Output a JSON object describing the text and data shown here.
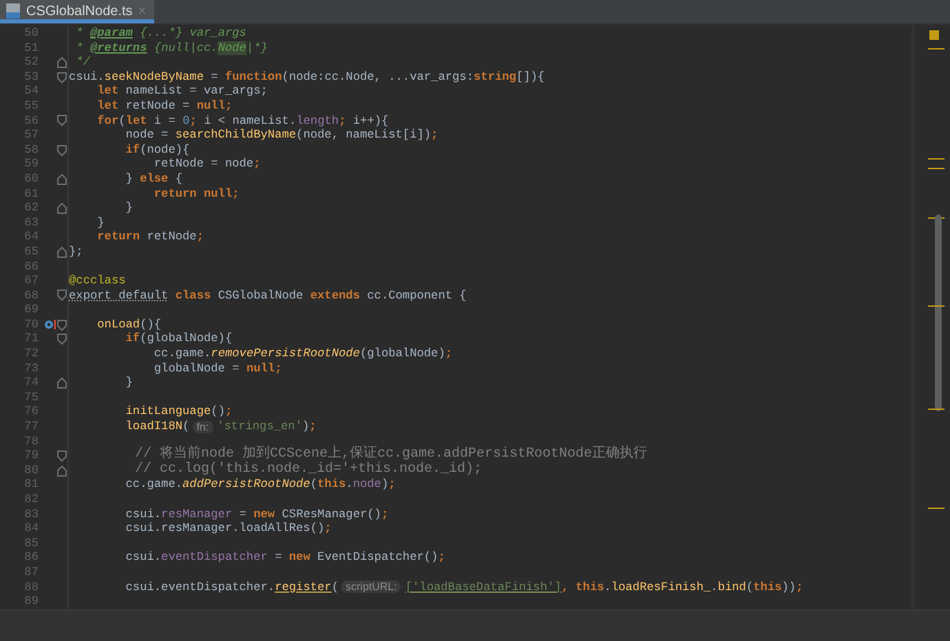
{
  "tabs": [
    {
      "label": "CSGlobalNode.ts",
      "close": "×",
      "selected": true
    }
  ],
  "lines": [
    {
      "number": "50",
      "fold_start": false,
      "fold_end": false,
      "override": false,
      "tokens": [
        {
          "kind": "doc",
          "text": " * "
        },
        {
          "kind": "doctag",
          "text": "@param"
        },
        {
          "kind": "doc",
          "text": " {...*} var_args"
        }
      ]
    },
    {
      "number": "51",
      "fold_start": false,
      "fold_end": false,
      "override": false,
      "tokens": [
        {
          "kind": "doc",
          "text": " * "
        },
        {
          "kind": "doctag",
          "text": "@returns"
        },
        {
          "kind": "doc",
          "text": " {null|cc."
        },
        {
          "kind": "docref",
          "text": "Node"
        },
        {
          "kind": "doc",
          "text": "|*}"
        }
      ]
    },
    {
      "number": "52",
      "fold_start": false,
      "fold_end": true,
      "override": false,
      "tokens": [
        {
          "kind": "doc",
          "text": " */"
        }
      ]
    },
    {
      "number": "53",
      "fold_start": true,
      "fold_end": false,
      "override": false,
      "tokens": [
        {
          "kind": "plain",
          "text": "csui."
        },
        {
          "kind": "function",
          "text": "seekNodeByName"
        },
        {
          "kind": "plain",
          "text": " = "
        },
        {
          "kind": "keyword",
          "text": "function"
        },
        {
          "kind": "plain",
          "text": "(node:cc.Node, ...var_args:"
        },
        {
          "kind": "keyword",
          "text": "string"
        },
        {
          "kind": "plain",
          "text": "[]){"
        }
      ]
    },
    {
      "number": "54",
      "fold_start": false,
      "fold_end": false,
      "override": false,
      "tokens": [
        {
          "kind": "keyword",
          "text": "    let"
        },
        {
          "kind": "plain",
          "text": " nameList = var_args;"
        }
      ]
    },
    {
      "number": "55",
      "fold_start": false,
      "fold_end": false,
      "override": false,
      "tokens": [
        {
          "kind": "keyword",
          "text": "    let"
        },
        {
          "kind": "plain",
          "text": " retNode = "
        },
        {
          "kind": "keyword",
          "text": "null;"
        }
      ]
    },
    {
      "number": "56",
      "fold_start": true,
      "fold_end": false,
      "override": false,
      "tokens": [
        {
          "kind": "keyword",
          "text": "    for"
        },
        {
          "kind": "plain",
          "text": "("
        },
        {
          "kind": "keyword",
          "text": "let"
        },
        {
          "kind": "plain",
          "text": " i = "
        },
        {
          "kind": "number",
          "text": "0"
        },
        {
          "kind": "keyword",
          "text": ";"
        },
        {
          "kind": "plain",
          "text": " i < nameList."
        },
        {
          "kind": "field",
          "text": "length"
        },
        {
          "kind": "keyword",
          "text": ";"
        },
        {
          "kind": "plain",
          "text": " i++){"
        }
      ]
    },
    {
      "number": "57",
      "fold_start": false,
      "fold_end": false,
      "override": false,
      "tokens": [
        {
          "kind": "plain",
          "text": "        node = "
        },
        {
          "kind": "function",
          "text": "searchChildByName"
        },
        {
          "kind": "plain",
          "text": "(node, nameList[i])"
        },
        {
          "kind": "keyword",
          "text": ";"
        }
      ]
    },
    {
      "number": "58",
      "fold_start": true,
      "fold_end": false,
      "override": false,
      "tokens": [
        {
          "kind": "keyword",
          "text": "        if"
        },
        {
          "kind": "plain",
          "text": "(node){"
        }
      ]
    },
    {
      "number": "59",
      "fold_start": false,
      "fold_end": false,
      "override": false,
      "tokens": [
        {
          "kind": "plain",
          "text": "            retNode = node"
        },
        {
          "kind": "keyword",
          "text": ";"
        }
      ]
    },
    {
      "number": "60",
      "fold_start": false,
      "fold_end": true,
      "override": false,
      "tokens": [
        {
          "kind": "plain",
          "text": "        } "
        },
        {
          "kind": "keyword",
          "text": "else"
        },
        {
          "kind": "plain",
          "text": " {"
        }
      ]
    },
    {
      "number": "61",
      "fold_start": false,
      "fold_end": false,
      "override": false,
      "tokens": [
        {
          "kind": "keyword",
          "text": "            return null;"
        }
      ]
    },
    {
      "number": "62",
      "fold_start": false,
      "fold_end": true,
      "override": false,
      "tokens": [
        {
          "kind": "plain",
          "text": "        }"
        }
      ]
    },
    {
      "number": "63",
      "fold_start": false,
      "fold_end": false,
      "override": false,
      "tokens": [
        {
          "kind": "plain",
          "text": "    }"
        }
      ]
    },
    {
      "number": "64",
      "fold_start": false,
      "fold_end": false,
      "override": false,
      "tokens": [
        {
          "kind": "keyword",
          "text": "    return"
        },
        {
          "kind": "plain",
          "text": " retNode"
        },
        {
          "kind": "keyword",
          "text": ";"
        }
      ]
    },
    {
      "number": "65",
      "fold_start": false,
      "fold_end": true,
      "override": false,
      "tokens": [
        {
          "kind": "plain",
          "text": "};"
        }
      ]
    },
    {
      "number": "66",
      "fold_start": false,
      "fold_end": false,
      "override": false
    },
    {
      "number": "67",
      "fold_start": false,
      "fold_end": false,
      "override": false,
      "tokens": [
        {
          "kind": "annotation",
          "text": "@ccclass"
        }
      ]
    },
    {
      "number": "68",
      "fold_start": true,
      "fold_end": false,
      "override": false,
      "tokens": [
        {
          "kind": "warning",
          "text": "export default"
        },
        {
          "kind": "keyword",
          "text": " class "
        },
        {
          "kind": "plain",
          "text": "CSGlobalNode "
        },
        {
          "kind": "keyword",
          "text": "extends"
        },
        {
          "kind": "plain",
          "text": " cc.Component {"
        }
      ]
    },
    {
      "number": "69",
      "fold_start": false,
      "fold_end": false,
      "override": false
    },
    {
      "number": "70",
      "fold_start": true,
      "fold_end": false,
      "override": true,
      "tokens": [
        {
          "kind": "function",
          "text": "    onLoad"
        },
        {
          "kind": "plain",
          "text": "(){"
        }
      ]
    },
    {
      "number": "71",
      "fold_start": true,
      "fold_end": false,
      "override": false,
      "tokens": [
        {
          "kind": "keyword",
          "text": "        if"
        },
        {
          "kind": "plain",
          "text": "(globalNode){"
        }
      ]
    },
    {
      "number": "72",
      "fold_start": false,
      "fold_end": false,
      "override": false,
      "tokens": [
        {
          "kind": "plain",
          "text": "            cc.game."
        },
        {
          "kind": "static",
          "text": "removePersistRootNode"
        },
        {
          "kind": "plain",
          "text": "(globalNode)"
        },
        {
          "kind": "keyword",
          "text": ";"
        }
      ]
    },
    {
      "number": "73",
      "fold_start": false,
      "fold_end": false,
      "override": false,
      "tokens": [
        {
          "kind": "plain",
          "text": "            globalNode = "
        },
        {
          "kind": "keyword",
          "text": "null;"
        }
      ]
    },
    {
      "number": "74",
      "fold_start": false,
      "fold_end": true,
      "override": false,
      "tokens": [
        {
          "kind": "plain",
          "text": "        }"
        }
      ]
    },
    {
      "number": "75",
      "fold_start": false,
      "fold_end": false,
      "override": false
    },
    {
      "number": "76",
      "fold_start": false,
      "fold_end": false,
      "override": false,
      "tokens": [
        {
          "kind": "function",
          "text": "        initLanguage"
        },
        {
          "kind": "plain",
          "text": "()"
        },
        {
          "kind": "keyword",
          "text": ";"
        }
      ]
    },
    {
      "number": "77",
      "fold_start": false,
      "fold_end": false,
      "override": false,
      "tokens": [
        {
          "kind": "function",
          "text": "        loadI18N"
        },
        {
          "kind": "plain",
          "text": "("
        },
        {
          "kind": "hint",
          "text": "fn:"
        },
        {
          "kind": "string",
          "text": "'strings_en'"
        },
        {
          "kind": "plain",
          "text": ")"
        },
        {
          "kind": "keyword",
          "text": ";"
        }
      ]
    },
    {
      "number": "78",
      "fold_start": false,
      "fold_end": false,
      "override": false
    },
    {
      "number": "79",
      "fold_start": true,
      "fold_end": false,
      "override": false,
      "tokens": [
        {
          "kind": "comment",
          "text": "        // 将当前node 加到CCScene上,保证cc.game.addPersistRootNode正确执行"
        }
      ]
    },
    {
      "number": "80",
      "fold_start": false,
      "fold_end": true,
      "override": false,
      "tokens": [
        {
          "kind": "comment",
          "text": "        // cc.log('this.node._id='+this.node._id);"
        }
      ]
    },
    {
      "number": "81",
      "fold_start": false,
      "fold_end": false,
      "override": false,
      "tokens": [
        {
          "kind": "plain",
          "text": "        cc.game."
        },
        {
          "kind": "static",
          "text": "addPersistRootNode"
        },
        {
          "kind": "plain",
          "text": "("
        },
        {
          "kind": "keyword",
          "text": "this"
        },
        {
          "kind": "plain",
          "text": "."
        },
        {
          "kind": "field",
          "text": "node"
        },
        {
          "kind": "plain",
          "text": ")"
        },
        {
          "kind": "keyword",
          "text": ";"
        }
      ]
    },
    {
      "number": "82",
      "fold_start": false,
      "fold_end": false,
      "override": false
    },
    {
      "number": "83",
      "fold_start": false,
      "fold_end": false,
      "override": false,
      "tokens": [
        {
          "kind": "plain",
          "text": "        csui."
        },
        {
          "kind": "field",
          "text": "resManager"
        },
        {
          "kind": "plain",
          "text": " = "
        },
        {
          "kind": "keyword",
          "text": "new"
        },
        {
          "kind": "plain",
          "text": " CSResManager()"
        },
        {
          "kind": "keyword",
          "text": ";"
        }
      ]
    },
    {
      "number": "84",
      "fold_start": false,
      "fold_end": false,
      "override": false,
      "tokens": [
        {
          "kind": "plain",
          "text": "        csui.resManager.loadAllRes()"
        },
        {
          "kind": "keyword",
          "text": ";"
        }
      ]
    },
    {
      "number": "85",
      "fold_start": false,
      "fold_end": false,
      "override": false
    },
    {
      "number": "86",
      "fold_start": false,
      "fold_end": false,
      "override": false,
      "tokens": [
        {
          "kind": "plain",
          "text": "        csui."
        },
        {
          "kind": "field",
          "text": "eventDispatcher"
        },
        {
          "kind": "plain",
          "text": " = "
        },
        {
          "kind": "keyword",
          "text": "new"
        },
        {
          "kind": "plain",
          "text": " EventDispatcher()"
        },
        {
          "kind": "keyword",
          "text": ";"
        }
      ]
    },
    {
      "number": "87",
      "fold_start": false,
      "fold_end": false,
      "override": false
    },
    {
      "number": "88",
      "fold_start": false,
      "fold_end": false,
      "override": false,
      "tokens": [
        {
          "kind": "plain",
          "text": "        csui.eventDispatcher."
        },
        {
          "kind": "function-warning",
          "text": "register"
        },
        {
          "kind": "plain",
          "text": "("
        },
        {
          "kind": "hint",
          "text": "scriptURL:"
        },
        {
          "kind": "string-warning",
          "text": "['loadBaseDataFinish']"
        },
        {
          "kind": "keyword",
          "text": ", this"
        },
        {
          "kind": "plain",
          "text": "."
        },
        {
          "kind": "function",
          "text": "loadResFinish_"
        },
        {
          "kind": "plain",
          "text": "."
        },
        {
          "kind": "function",
          "text": "bind"
        },
        {
          "kind": "plain",
          "text": "("
        },
        {
          "kind": "keyword",
          "text": "this"
        },
        {
          "kind": "plain",
          "text": "))"
        },
        {
          "kind": "keyword",
          "text": ";"
        }
      ]
    },
    {
      "number": "89",
      "fold_start": false,
      "fold_end": false,
      "override": false
    }
  ]
}
